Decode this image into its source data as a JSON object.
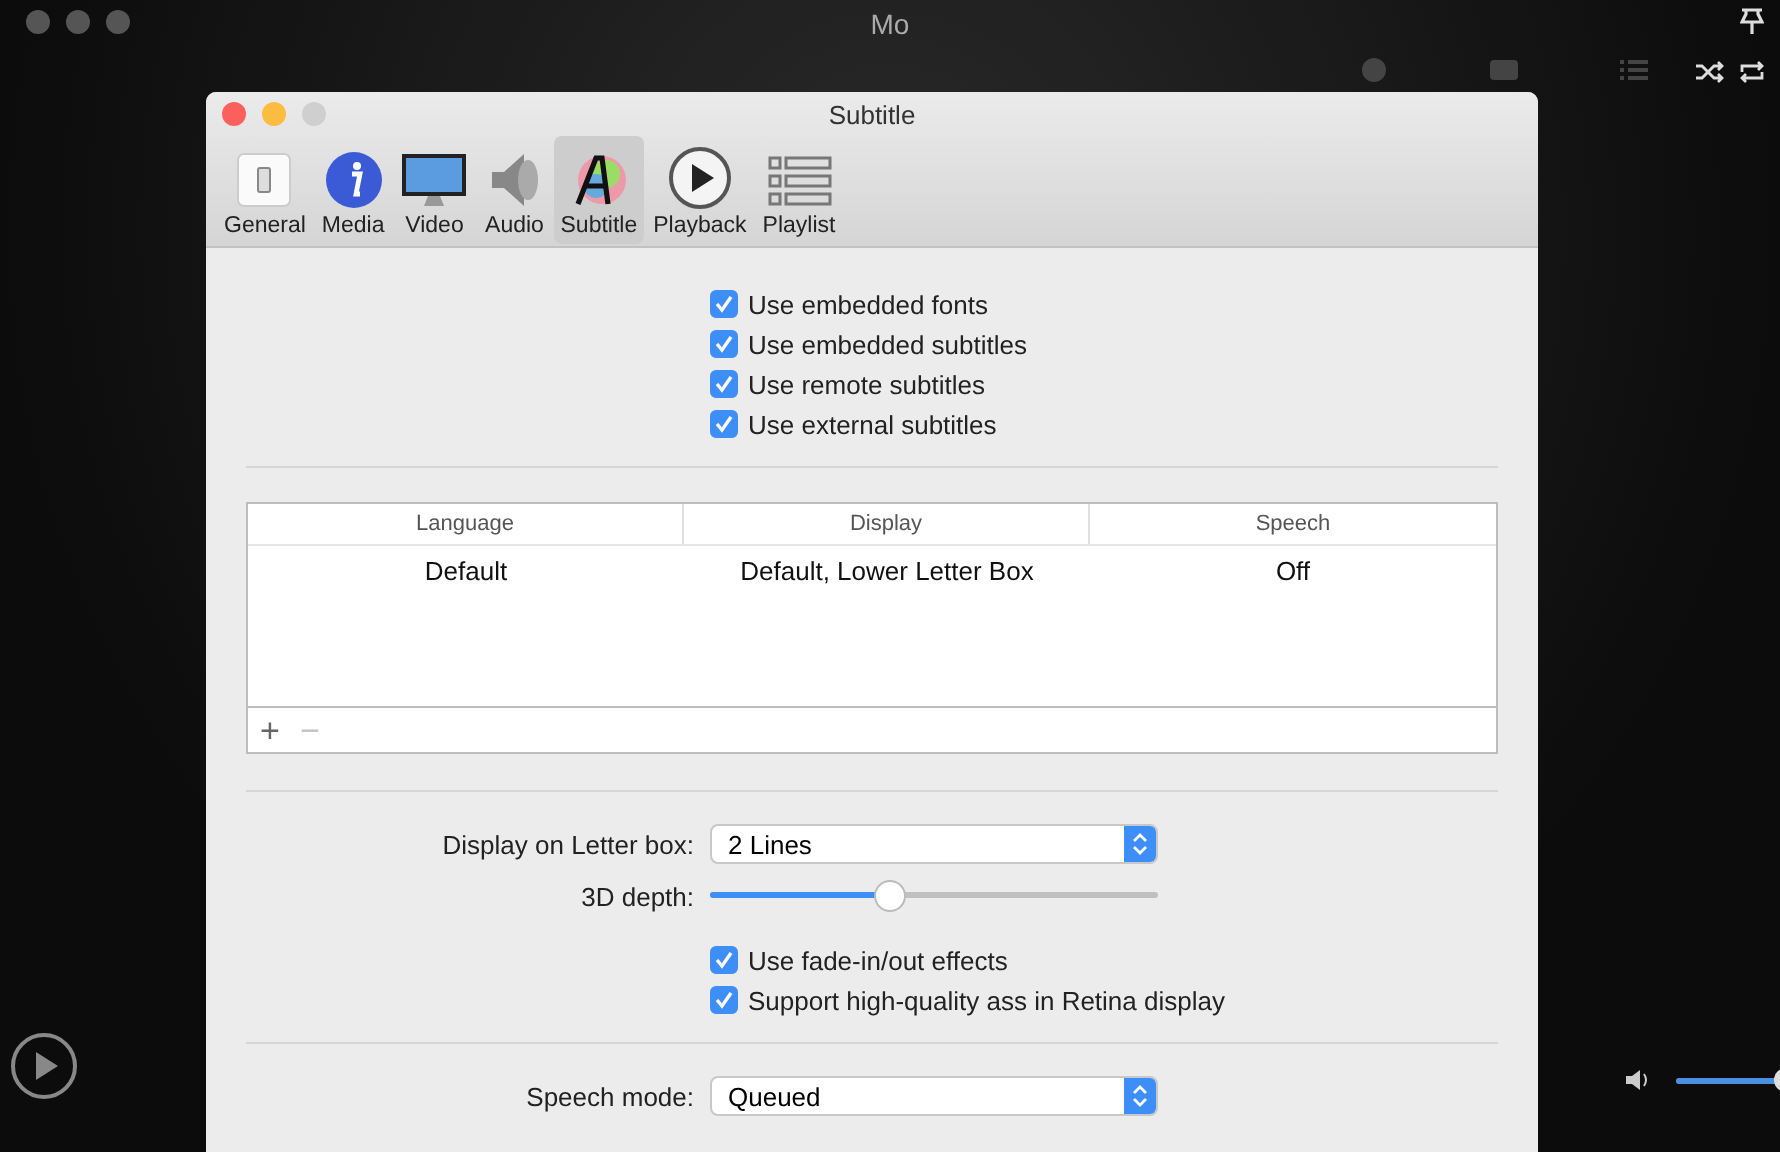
{
  "background_window": {
    "title": "Mo",
    "volume": {
      "level": 0.95
    }
  },
  "window": {
    "title": "Subtitle"
  },
  "tabs": [
    {
      "label": "General",
      "kind": "switch",
      "selected": false
    },
    {
      "label": "Media",
      "kind": "info",
      "selected": false
    },
    {
      "label": "Video",
      "kind": "monitor",
      "selected": false
    },
    {
      "label": "Audio",
      "kind": "speaker",
      "selected": false
    },
    {
      "label": "Subtitle",
      "kind": "letter",
      "selected": true
    },
    {
      "label": "Playback",
      "kind": "play",
      "selected": false
    },
    {
      "label": "Playlist",
      "kind": "list",
      "selected": false
    }
  ],
  "source_options": [
    {
      "label": "Use embedded fonts",
      "checked": true
    },
    {
      "label": "Use embedded subtitles",
      "checked": true
    },
    {
      "label": "Use remote subtitles",
      "checked": true
    },
    {
      "label": "Use external subtitles",
      "checked": true
    }
  ],
  "table": {
    "columns": [
      "Language",
      "Display",
      "Speech"
    ],
    "rows": [
      [
        "Default",
        "Default, Lower Letter Box",
        "Off"
      ]
    ],
    "buttons": [
      {
        "label": "+",
        "disabled": false
      },
      {
        "label": "−",
        "disabled": true
      }
    ]
  },
  "letter_box": {
    "label": "Display on Letter box:",
    "value": "2 Lines"
  },
  "depth": {
    "label": "3D depth:",
    "level": 0.4
  },
  "render_options": [
    {
      "label": "Use fade-in/out effects",
      "checked": true
    },
    {
      "label": "Support high-quality ass in Retina display",
      "checked": true
    }
  ],
  "speech_mode": {
    "label": "Speech mode:",
    "value": "Queued"
  }
}
